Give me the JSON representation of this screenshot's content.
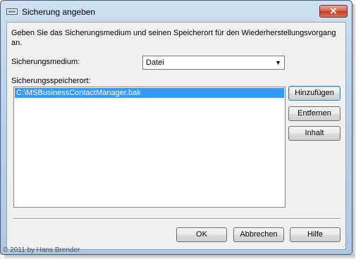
{
  "window": {
    "title": "Sicherung angeben",
    "close_label": "✕"
  },
  "description": "Geben Sie das Sicherungsmedium und seinen Speicherort für den Wiederherstellungsvorgang an.",
  "medium": {
    "label": "Sicherungsmedium:",
    "selected": "Datei"
  },
  "location": {
    "label": "Sicherungsspeicherort:",
    "items": [
      "C:\\MSBusinessContactManager.bak"
    ]
  },
  "side_buttons": {
    "add": "Hinzufügen",
    "remove": "Entfernen",
    "contents": "Inhalt"
  },
  "footer_buttons": {
    "ok": "OK",
    "cancel": "Abbrechen",
    "help": "Hilfe"
  },
  "watermark": "© 2011 by Hans Brender"
}
